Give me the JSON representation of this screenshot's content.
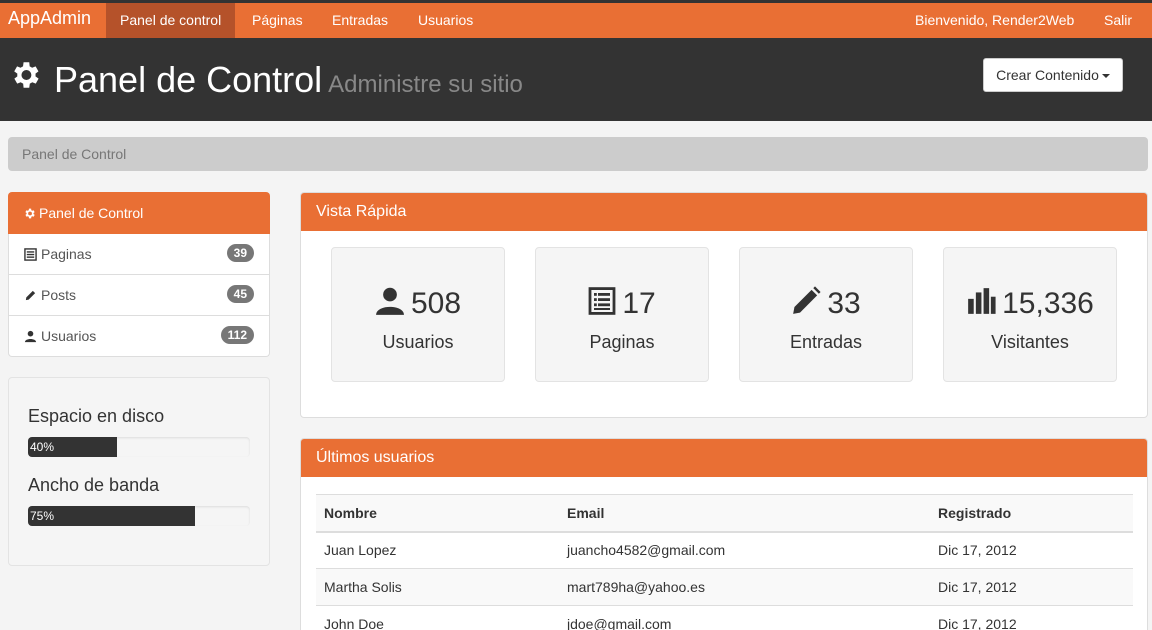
{
  "nav": {
    "brand": "AppAdmin",
    "links": [
      "Panel de control",
      "Páginas",
      "Entradas",
      "Usuarios"
    ],
    "welcome": "Bienvenido, Render2Web",
    "logout": "Salir"
  },
  "header": {
    "title": "Panel de Control",
    "subtitle": "Administre su sitio",
    "create_button": "Crear Contenido"
  },
  "breadcrumb": "Panel de Control",
  "sidebar": {
    "header": "Panel de Control",
    "items": [
      {
        "label": "Paginas",
        "count": "39",
        "icon": "list-icon"
      },
      {
        "label": "Posts",
        "count": "45",
        "icon": "pencil-icon"
      },
      {
        "label": "Usuarios",
        "count": "112",
        "icon": "user-icon"
      }
    ]
  },
  "usage": {
    "disk": {
      "label": "Espacio en disco",
      "text": "40%",
      "value": 40
    },
    "bandwidth": {
      "label": "Ancho de banda",
      "text": "75%",
      "value": 75
    }
  },
  "overview": {
    "title": "Vista Rápida",
    "stats": [
      {
        "value": "508",
        "label": "Usuarios",
        "icon": "user-icon"
      },
      {
        "value": "17",
        "label": "Paginas",
        "icon": "list-icon"
      },
      {
        "value": "33",
        "label": "Entradas",
        "icon": "pencil-icon"
      },
      {
        "value": "15,336",
        "label": "Visitantes",
        "icon": "bar-chart-icon"
      }
    ]
  },
  "latest_users": {
    "title": "Últimos usuarios",
    "columns": [
      "Nombre",
      "Email",
      "Registrado"
    ],
    "rows": [
      [
        "Juan Lopez",
        "juancho4582@gmail.com",
        "Dic 17, 2012"
      ],
      [
        "Martha Solis",
        "mart789ha@yahoo.es",
        "Dic 17, 2012"
      ],
      [
        "John Doe",
        "jdoe@gmail.com",
        "Dic 17, 2012"
      ]
    ]
  },
  "colors": {
    "accent": "#e96f34",
    "dark": "#333333"
  }
}
